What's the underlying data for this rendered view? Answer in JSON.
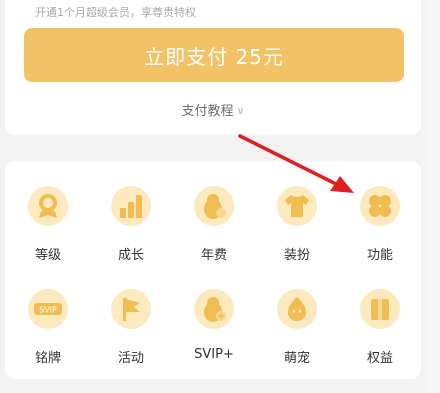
{
  "pay": {
    "subtitle": "开通1个月超级会员，享尊贵特权",
    "button": "立即支付 25元",
    "tutorial": "支付教程",
    "tutorial_icon": "chevron-down-icon"
  },
  "menu": {
    "row1": [
      {
        "label": "等级",
        "icon": "medal-icon"
      },
      {
        "label": "成长",
        "icon": "growth-bars-icon"
      },
      {
        "label": "年费",
        "icon": "penguin-bag-icon"
      },
      {
        "label": "装扮",
        "icon": "tshirt-icon"
      },
      {
        "label": "功能",
        "icon": "clover-icon"
      }
    ],
    "row2": [
      {
        "label": "铭牌",
        "icon": "svip-badge-icon"
      },
      {
        "label": "活动",
        "icon": "flag-icon"
      },
      {
        "label": "SVIP+",
        "icon": "penguin-plus-icon"
      },
      {
        "label": "萌宠",
        "icon": "pet-egg-icon"
      },
      {
        "label": "权益",
        "icon": "gift-box-icon"
      }
    ]
  },
  "colors": {
    "accent": "#f3c266",
    "icon_bg": "#fce9bd",
    "icon_fg": "#f0bd52",
    "arrow": "#e02020"
  }
}
